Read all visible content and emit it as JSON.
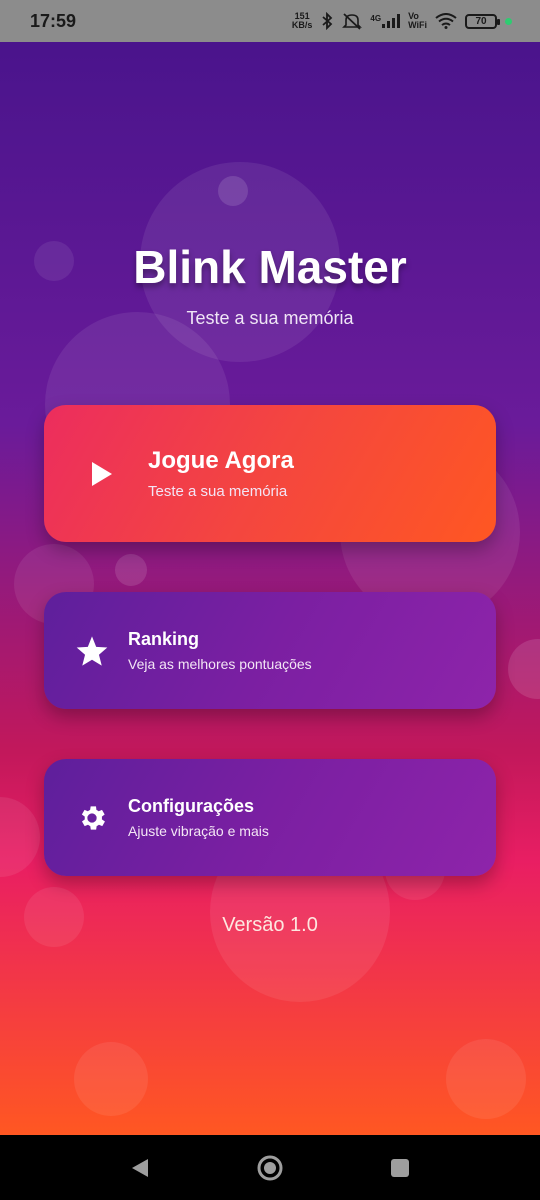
{
  "status_bar": {
    "time": "17:59",
    "net_speed_value": "151",
    "net_speed_unit": "KB/s",
    "network": "4G",
    "vo_label": "Vo",
    "wifi_label": "WiFi",
    "battery": "70"
  },
  "app": {
    "title": "Blink Master",
    "subtitle": "Teste a sua memória",
    "colors": {
      "play_start": "#ec2d5e",
      "play_end": "#ff5722",
      "card_purple": "#7b1fa2"
    }
  },
  "menu": {
    "play": {
      "title": "Jogue Agora",
      "subtitle": "Teste a sua memória",
      "icon": "play-icon"
    },
    "ranking": {
      "title": "Ranking",
      "subtitle": "Veja as melhores pontuações",
      "icon": "star-icon"
    },
    "settings": {
      "title": "Configurações",
      "subtitle": "Ajuste vibração e mais",
      "icon": "gear-icon"
    }
  },
  "version": "Versão 1.0",
  "nav": {
    "back_icon": "back-icon",
    "home_icon": "home-icon",
    "recents_icon": "recents-icon"
  }
}
